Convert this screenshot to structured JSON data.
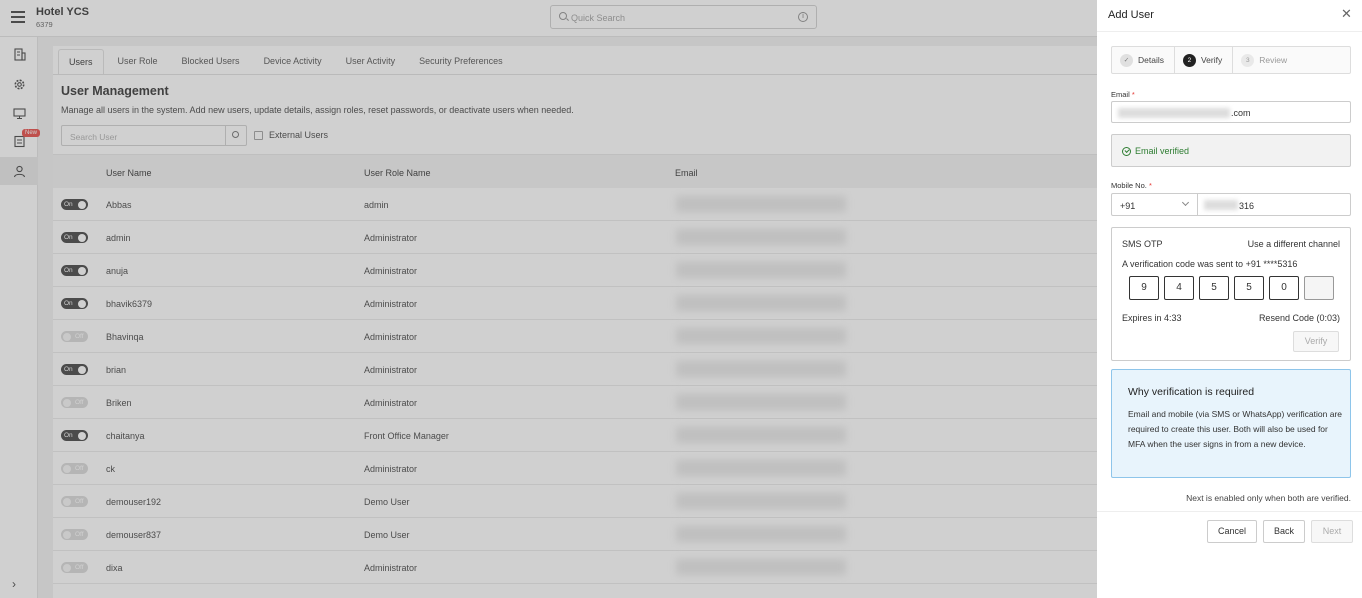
{
  "header": {
    "hotel_name": "Hotel YCS",
    "hotel_code": "6379",
    "search_placeholder": "Quick Search"
  },
  "sidebar": {
    "new_badge": "New"
  },
  "tabs": [
    "Users",
    "User Role",
    "Blocked Users",
    "Device Activity",
    "User Activity",
    "Security Preferences"
  ],
  "main": {
    "title": "User Management",
    "description": "Manage all users in the system. Add new users, update details, assign roles, reset passwords, or deactivate users when needed.",
    "search_placeholder": "Search User",
    "external_users_label": "External Users",
    "columns": {
      "name": "User Name",
      "role": "User Role Name",
      "email": "Email"
    },
    "rows": [
      {
        "status": "On",
        "name": "Abbas",
        "role": "admin"
      },
      {
        "status": "On",
        "name": "admin",
        "role": "Administrator"
      },
      {
        "status": "On",
        "name": "anuja",
        "role": "Administrator"
      },
      {
        "status": "On",
        "name": "bhavik6379",
        "role": "Administrator"
      },
      {
        "status": "Off",
        "name": "Bhavinqa",
        "role": "Administrator"
      },
      {
        "status": "On",
        "name": "brian",
        "role": "Administrator"
      },
      {
        "status": "Off",
        "name": "Briken",
        "role": "Administrator"
      },
      {
        "status": "On",
        "name": "chaitanya",
        "role": "Front Office Manager"
      },
      {
        "status": "Off",
        "name": "ck",
        "role": "Administrator"
      },
      {
        "status": "Off",
        "name": "demouser192",
        "role": "Demo User"
      },
      {
        "status": "Off",
        "name": "demouser837",
        "role": "Demo User"
      },
      {
        "status": "Off",
        "name": "dixa",
        "role": "Administrator"
      }
    ]
  },
  "drawer": {
    "title": "Add User",
    "steps": [
      {
        "num": "",
        "label": "Details",
        "state": "done"
      },
      {
        "num": "2",
        "label": "Verify",
        "state": "current"
      },
      {
        "num": "3",
        "label": "Review",
        "state": "todo"
      }
    ],
    "email_label": "Email",
    "email_suffix": ".com",
    "email_verified": "Email verified",
    "mobile_label": "Mobile No.",
    "country_code": "+91",
    "mobile_suffix": "316",
    "otp": {
      "title": "SMS OTP",
      "channel_link": "Use a different channel",
      "sent_text": "A verification code was sent to +91 ****5316",
      "digits": [
        "9",
        "4",
        "5",
        "5",
        "0",
        ""
      ],
      "expires": "Expires in 4:33",
      "resend": "Resend Code (0:03)",
      "verify_button": "Verify"
    },
    "why": {
      "title": "Why verification is required",
      "body": "Email and mobile (via SMS or WhatsApp) verification are required to create this user. Both will also be used for MFA when the user signs in from a new device."
    },
    "note": "Next is enabled only when both are verified.",
    "buttons": {
      "cancel": "Cancel",
      "back": "Back",
      "next": "Next"
    }
  }
}
